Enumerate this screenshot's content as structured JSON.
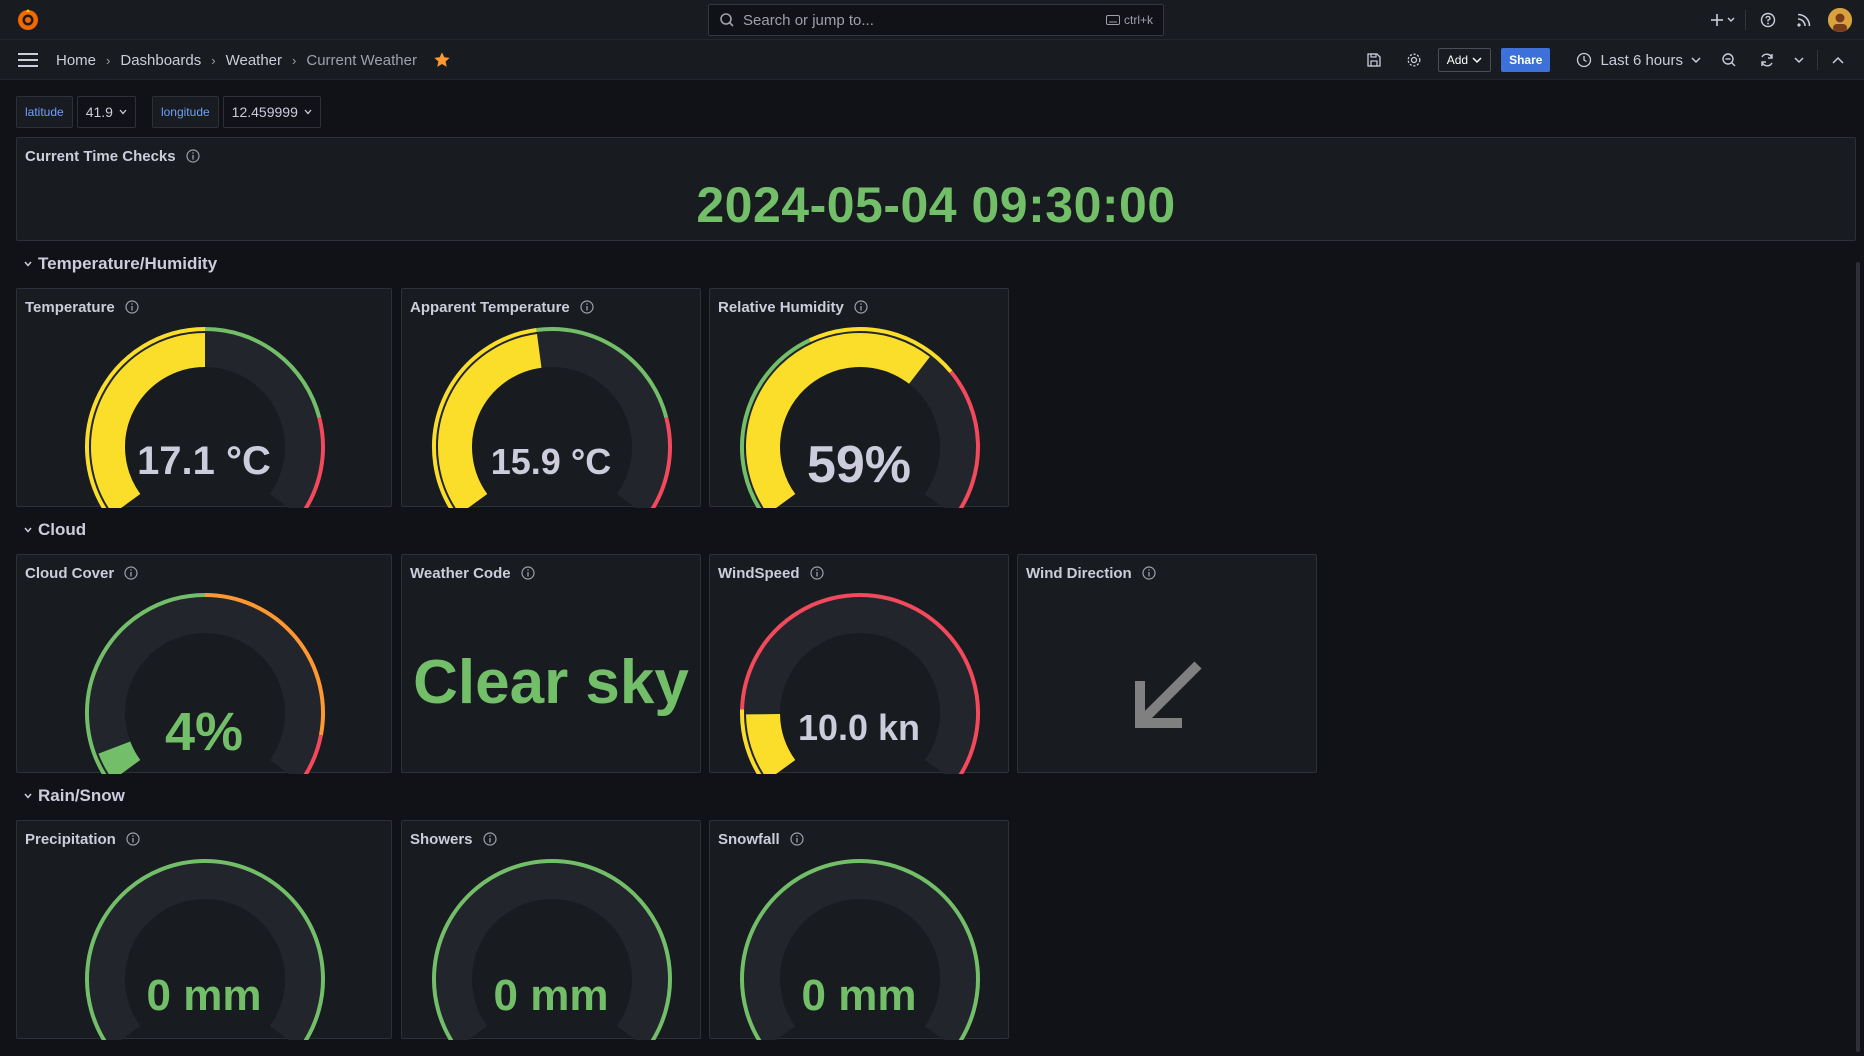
{
  "topbar": {
    "search_placeholder": "Search or jump to...",
    "search_shortcut": "ctrl+k"
  },
  "breadcrumb": {
    "items": [
      "Home",
      "Dashboards",
      "Weather"
    ],
    "current": "Current Weather"
  },
  "toolbar": {
    "add_label": "Add",
    "share_label": "Share",
    "time_range": "Last 6 hours"
  },
  "variables": [
    {
      "label": "latitude",
      "value": "41.9"
    },
    {
      "label": "longitude",
      "value": "12.459999"
    }
  ],
  "time_panel": {
    "title": "Current Time Checks",
    "value": "2024-05-04 09:30:00"
  },
  "rows": {
    "temp": "Temperature/Humidity",
    "cloud": "Cloud",
    "rain": "Rain/Snow"
  },
  "gauges": {
    "temperature": {
      "title": "Temperature",
      "value": "17.1 °C",
      "fraction": 0.5,
      "color": "#fade2a"
    },
    "apparent": {
      "title": "Apparent Temperature",
      "value": "15.9 °C",
      "fraction": 0.47,
      "color": "#fade2a"
    },
    "humidity": {
      "title": "Relative Humidity",
      "value": "59%",
      "fraction": 0.65,
      "color": "#fade2a"
    },
    "cloud": {
      "title": "Cloud Cover",
      "value": "4%",
      "fraction": 0.06,
      "color": "#73bf69"
    },
    "wind": {
      "title": "WindSpeed",
      "value": "10.0 kn",
      "fraction": 0.14,
      "color": "#fade2a"
    },
    "precip": {
      "title": "Precipitation",
      "value": "0 mm",
      "fraction": 0,
      "color": "#73bf69"
    },
    "showers": {
      "title": "Showers",
      "value": "0 mm",
      "fraction": 0,
      "color": "#73bf69"
    },
    "snow": {
      "title": "Snowfall",
      "value": "0 mm",
      "fraction": 0,
      "color": "#73bf69"
    }
  },
  "weather_code": {
    "title": "Weather Code",
    "value": "Clear sky"
  },
  "wind_direction": {
    "title": "Wind Direction",
    "icon": "arrow-down-left-icon"
  },
  "colors": {
    "green": "#73bf69",
    "yellow": "#fade2a",
    "orange": "#ff9830",
    "red": "#f2495c",
    "accent": "#3d71d9"
  }
}
